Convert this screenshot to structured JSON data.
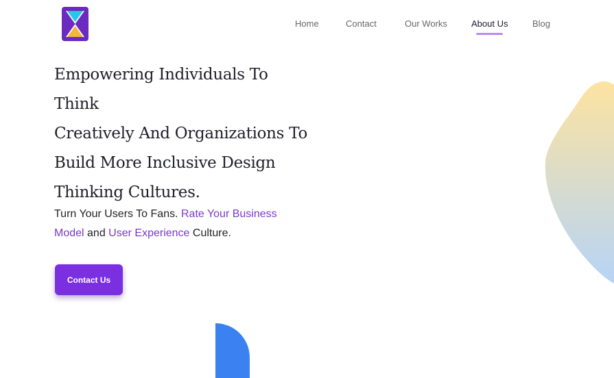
{
  "header": {
    "logo": {
      "icon": "x-logo-icon",
      "brand_color": "#6b2bbf"
    },
    "nav": [
      {
        "label": "Home",
        "active": false
      },
      {
        "label": "Contact",
        "active": false
      },
      {
        "label": "Our Works",
        "active": false
      },
      {
        "label": "About Us",
        "active": true
      },
      {
        "label": "Blog",
        "active": false
      }
    ]
  },
  "hero": {
    "headline_lines": [
      "Empowering Individuals To Think",
      "Creatively And Organizations To",
      "Build More Inclusive Design",
      "Thinking Cultures."
    ],
    "subtext": {
      "part1": "Turn Your Users To Fans. ",
      "highlight1": "Rate Your Business Model",
      "part2": " and ",
      "highlight2": "User Experience",
      "part3": " Culture."
    },
    "cta_label": "Contact Us"
  },
  "colors": {
    "accent": "#7a2fe0",
    "highlight_text": "#7a38c9",
    "nav_underline": "#b68cf0",
    "blob_top": "#fde3a0",
    "blob_bottom": "#b6d4f7",
    "half_circle": "#3b82f0"
  }
}
